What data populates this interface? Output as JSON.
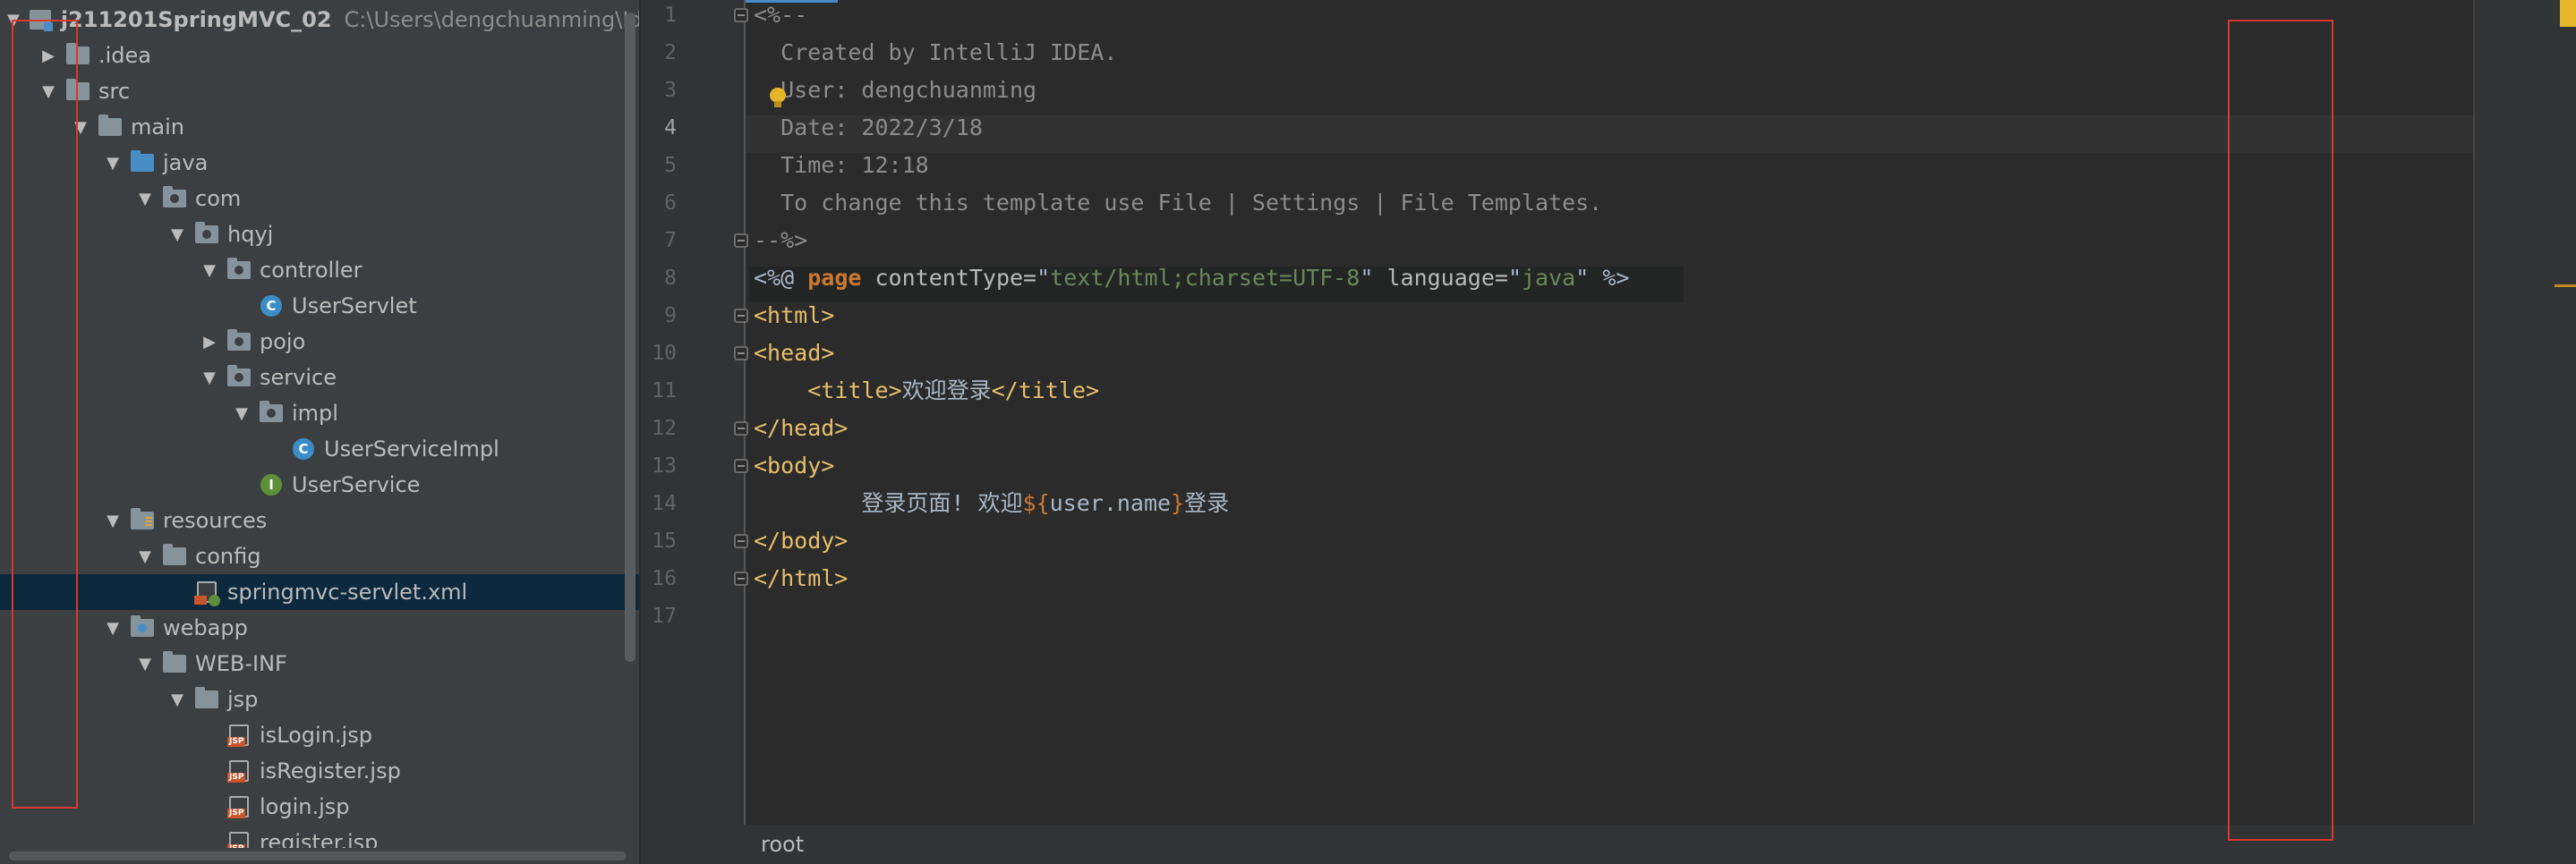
{
  "project_tree": {
    "items": [
      {
        "depth": 0,
        "arrow": "down",
        "icon": "module-folder-icon",
        "label": "j211201SpringMVC_02",
        "path": "C:\\Users\\dengchuanming\\Idea"
      },
      {
        "depth": 1,
        "arrow": "right",
        "icon": "folder-icon",
        "label": ".idea"
      },
      {
        "depth": 1,
        "arrow": "down",
        "icon": "folder-icon",
        "label": "src"
      },
      {
        "depth": 2,
        "arrow": "down",
        "icon": "folder-icon",
        "label": "main"
      },
      {
        "depth": 3,
        "arrow": "down",
        "icon": "source-folder-icon",
        "label": "java"
      },
      {
        "depth": 4,
        "arrow": "down",
        "icon": "package-icon",
        "label": "com"
      },
      {
        "depth": 5,
        "arrow": "down",
        "icon": "package-icon",
        "label": "hqyj"
      },
      {
        "depth": 6,
        "arrow": "down",
        "icon": "package-icon",
        "label": "controller"
      },
      {
        "depth": 7,
        "arrow": "none",
        "icon": "class-icon",
        "label": "UserServlet"
      },
      {
        "depth": 6,
        "arrow": "right",
        "icon": "package-icon",
        "label": "pojo"
      },
      {
        "depth": 6,
        "arrow": "down",
        "icon": "package-icon",
        "label": "service"
      },
      {
        "depth": 7,
        "arrow": "down",
        "icon": "package-icon",
        "label": "impl"
      },
      {
        "depth": 8,
        "arrow": "none",
        "icon": "class-icon",
        "label": "UserServiceImpl"
      },
      {
        "depth": 7,
        "arrow": "none",
        "icon": "interface-icon",
        "label": "UserService"
      },
      {
        "depth": 3,
        "arrow": "down",
        "icon": "resources-folder-icon",
        "label": "resources"
      },
      {
        "depth": 4,
        "arrow": "down",
        "icon": "folder-icon",
        "label": "config"
      },
      {
        "depth": 5,
        "arrow": "none",
        "icon": "xml-file-icon",
        "label": "springmvc-servlet.xml",
        "selected": true
      },
      {
        "depth": 3,
        "arrow": "down",
        "icon": "web-folder-icon",
        "label": "webapp"
      },
      {
        "depth": 4,
        "arrow": "down",
        "icon": "folder-icon",
        "label": "WEB-INF"
      },
      {
        "depth": 5,
        "arrow": "down",
        "icon": "folder-icon",
        "label": "jsp"
      },
      {
        "depth": 6,
        "arrow": "none",
        "icon": "jsp-file-icon",
        "label": "isLogin.jsp"
      },
      {
        "depth": 6,
        "arrow": "none",
        "icon": "jsp-file-icon",
        "label": "isRegister.jsp"
      },
      {
        "depth": 6,
        "arrow": "none",
        "icon": "jsp-file-icon",
        "label": "login.jsp"
      },
      {
        "depth": 6,
        "arrow": "none",
        "icon": "jsp-file-icon",
        "label": "register.jsp"
      }
    ]
  },
  "editor": {
    "current_line": 4,
    "lines": [
      {
        "n": "1",
        "fold": true,
        "tokens": [
          {
            "c": "comment",
            "t": "<%--"
          }
        ]
      },
      {
        "n": "2",
        "tokens": [
          {
            "c": "comment",
            "t": "  Created by IntelliJ IDEA."
          }
        ]
      },
      {
        "n": "3",
        "tokens": [
          {
            "c": "comment",
            "t": "  User: dengchuanming"
          }
        ]
      },
      {
        "n": "4",
        "tokens": [
          {
            "c": "comment",
            "t": "  Date: 2022/3/18"
          }
        ]
      },
      {
        "n": "5",
        "tokens": [
          {
            "c": "comment",
            "t": "  Time: 12:18"
          }
        ]
      },
      {
        "n": "6",
        "tokens": [
          {
            "c": "comment",
            "t": "  To change this template use File | Settings | File Templates."
          }
        ]
      },
      {
        "n": "7",
        "fold": true,
        "tokens": [
          {
            "c": "comment",
            "t": "--%>"
          }
        ]
      },
      {
        "n": "8",
        "tokens": [
          {
            "c": "text",
            "t": "<%@ "
          },
          {
            "c": "kw",
            "t": "page"
          },
          {
            "c": "attr",
            "t": " contentType="
          },
          {
            "c": "strq",
            "t": "\""
          },
          {
            "c": "str",
            "t": "text/html;charset=UTF-8"
          },
          {
            "c": "strq",
            "t": "\""
          },
          {
            "c": "attr",
            "t": " language="
          },
          {
            "c": "strq",
            "t": "\""
          },
          {
            "c": "str",
            "t": "java"
          },
          {
            "c": "strq",
            "t": "\""
          },
          {
            "c": "text",
            "t": " %>"
          }
        ]
      },
      {
        "n": "9",
        "fold": true,
        "tokens": [
          {
            "c": "tag",
            "t": "<html>"
          }
        ]
      },
      {
        "n": "10",
        "fold": true,
        "tokens": [
          {
            "c": "tag",
            "t": "<head>"
          }
        ]
      },
      {
        "n": "11",
        "tokens": [
          {
            "c": "text",
            "t": "    "
          },
          {
            "c": "tag",
            "t": "<title>"
          },
          {
            "c": "text",
            "t": "欢迎登录"
          },
          {
            "c": "tag",
            "t": "</title>"
          }
        ]
      },
      {
        "n": "12",
        "fold": true,
        "tokens": [
          {
            "c": "tag",
            "t": "</head>"
          }
        ]
      },
      {
        "n": "13",
        "fold": true,
        "tokens": [
          {
            "c": "tag",
            "t": "<body>"
          }
        ]
      },
      {
        "n": "14",
        "tokens": [
          {
            "c": "text",
            "t": "        登录页面! 欢迎"
          },
          {
            "c": "el",
            "t": "${"
          },
          {
            "c": "elvar",
            "t": "user.name"
          },
          {
            "c": "el",
            "t": "}"
          },
          {
            "c": "text",
            "t": "登录"
          }
        ]
      },
      {
        "n": "15",
        "fold": true,
        "tokens": [
          {
            "c": "tag",
            "t": "</body>"
          }
        ]
      },
      {
        "n": "16",
        "fold": true,
        "tokens": [
          {
            "c": "tag",
            "t": "</html>"
          }
        ]
      },
      {
        "n": "17",
        "tokens": []
      }
    ]
  },
  "status_bar": {
    "breadcrumb": "root"
  },
  "colors": {
    "panel_bg": "#3c3f41",
    "editor_bg": "#2b2b2b",
    "selection": "#0d293e",
    "highlight_box": "#d7382f"
  }
}
